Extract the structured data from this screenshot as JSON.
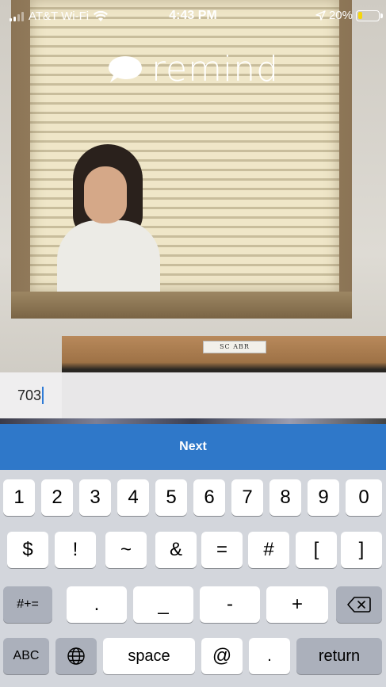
{
  "status_bar": {
    "carrier": "AT&T Wi-Fi",
    "time": "4:43 PM",
    "battery_percent": "20%",
    "battery_level": 0.2,
    "icons": [
      "signal-icon",
      "wifi-icon",
      "location-arrow-icon",
      "battery-icon"
    ]
  },
  "brand": {
    "name": "remind",
    "icon": "speech-bubble-icon"
  },
  "background": {
    "nameplate_text": "SC ABR"
  },
  "input": {
    "value": "703"
  },
  "next_button": {
    "label": "Next",
    "color": "#2f78c9"
  },
  "keyboard": {
    "row1": [
      "1",
      "2",
      "3",
      "4",
      "5",
      "6",
      "7",
      "8",
      "9",
      "0"
    ],
    "row2": [
      "$",
      "!",
      "~",
      "&",
      "=",
      "#",
      "[",
      "]"
    ],
    "row3": {
      "shift": "#+=",
      "keys": [
        ".",
        "_",
        "-",
        "+"
      ],
      "delete_icon": "backspace-icon"
    },
    "row4": {
      "abc": "ABC",
      "globe_icon": "globe-icon",
      "space": "space",
      "at": "@",
      "dot": ".",
      "return": "return"
    }
  }
}
